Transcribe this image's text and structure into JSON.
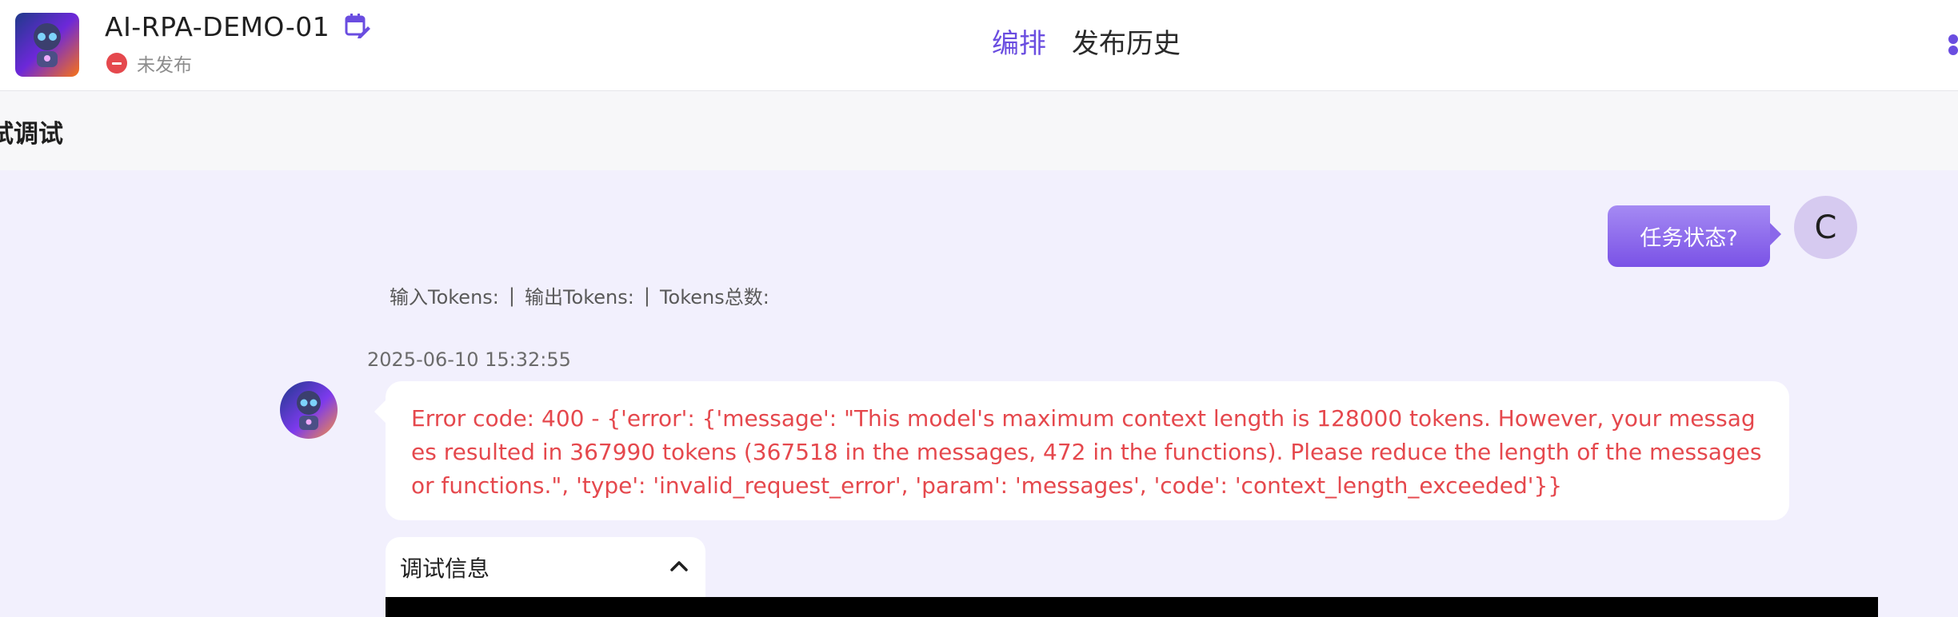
{
  "header": {
    "app_title": "AI-RPA-DEMO-01",
    "status_text": "未发布",
    "tabs": [
      {
        "label": "编排",
        "active": true
      },
      {
        "label": "发布历史",
        "active": false
      }
    ]
  },
  "subbar": {
    "title": "试调试"
  },
  "chat": {
    "user_message": "任务状态?",
    "user_avatar_letter": "C",
    "tokens": {
      "input_label": "输入Tokens:",
      "output_label": "输出Tokens:",
      "total_label": "Tokens总数:",
      "separator": "|"
    },
    "timestamp": "2025-06-10 15:32:55",
    "error_message": "Error code: 400 - {'error': {'message': \"This model's maximum context length is 128000 tokens. However, your messages resulted in 367990 tokens (367518 in the messages, 472 in the functions). Please reduce the length of the messages or functions.\", 'type': 'invalid_request_error', 'param': 'messages', 'code': 'context_length_exceeded'}}",
    "debug_label": "调试信息"
  },
  "colors": {
    "accent": "#6a4de0",
    "error": "#e5484d",
    "chat_background": "#f2f0fd",
    "user_bubble": "#8a67ea"
  },
  "icons": [
    "edit-calendar-icon",
    "status-unpublished-icon",
    "chevron-up-icon",
    "robot-avatar-icon"
  ]
}
